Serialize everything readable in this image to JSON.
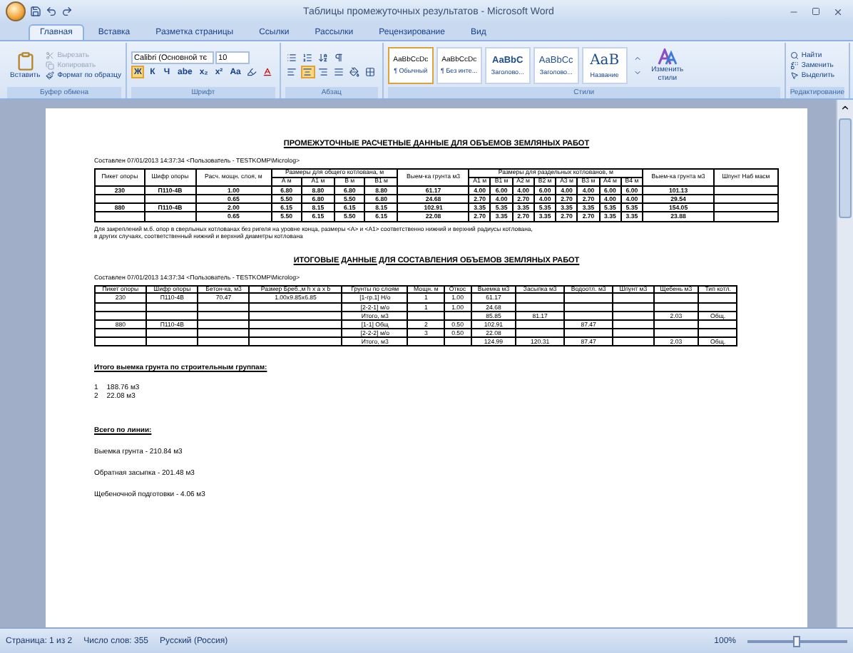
{
  "window": {
    "title": "Таблицы промежуточных результатов - Microsoft Word"
  },
  "tabs": [
    {
      "label": "Главная",
      "selected": true
    },
    {
      "label": "Вставка",
      "selected": false
    },
    {
      "label": "Разметка страницы",
      "selected": false
    },
    {
      "label": "Ссылки",
      "selected": false
    },
    {
      "label": "Рассылки",
      "selected": false
    },
    {
      "label": "Рецензирование",
      "selected": false
    },
    {
      "label": "Вид",
      "selected": false
    }
  ],
  "clipboard": {
    "group": "Буфер обмена",
    "paste": "Вставить",
    "items": [
      {
        "kind": "cut",
        "label": "Вырезать",
        "disabled": true
      },
      {
        "kind": "copy",
        "label": "Копировать",
        "disabled": true
      },
      {
        "kind": "format",
        "label": "Формат по образцу",
        "disabled": false
      }
    ]
  },
  "font": {
    "group": "Шрифт",
    "name": "Calibri (Основной тє",
    "size": "10",
    "buttons": [
      {
        "label": "Ж",
        "on": true
      },
      {
        "label": "К",
        "on": false
      },
      {
        "label": "Ч",
        "on": false
      },
      {
        "label": "abe",
        "on": false
      },
      {
        "label": "x₂",
        "on": false
      },
      {
        "label": "x²",
        "on": false
      },
      {
        "label": "Aa",
        "on": false
      }
    ]
  },
  "paragraph": {
    "group": "Абзац",
    "align": [
      {
        "kind": "left",
        "selected": false
      },
      {
        "kind": "center",
        "selected": true
      },
      {
        "kind": "right",
        "selected": false
      },
      {
        "kind": "justify",
        "selected": false
      }
    ]
  },
  "styles": {
    "group": "Стили",
    "items": [
      {
        "preview": "AaBbCcDc",
        "label": "¶ Обычный",
        "kind": "normal",
        "selected": true
      },
      {
        "preview": "AaBbCcDc",
        "label": "¶ Без инте...",
        "kind": "normal",
        "selected": false
      },
      {
        "preview": "AaBbC",
        "label": "Заголово...",
        "kind": "heading",
        "selected": false
      },
      {
        "preview": "AaBbCc",
        "label": "Заголово...",
        "kind": "heading2",
        "selected": false
      },
      {
        "preview": "AaB",
        "label": "Название",
        "kind": "title",
        "selected": false
      }
    ],
    "change": "Изменить стили"
  },
  "editing": {
    "group": "Редактирование",
    "items": [
      {
        "kind": "find",
        "label": "Найти"
      },
      {
        "kind": "replace",
        "label": "Заменить"
      },
      {
        "kind": "select",
        "label": "Выделить"
      }
    ]
  },
  "document": {
    "title1": "ПРОМЕЖУТОЧНЫЕ  РАСЧЕТНЫЕ ДАННЫЕ ДЛЯ ОБЪЕМОВ ЗЕМЛЯНЫХ РАБОТ",
    "author1": "Составлен 07/01/2013 14:37:34 <Пользователь - TESTKOMP\\Microlog>",
    "table1": {
      "columns": [
        {
          "label": "Пикет опоры"
        },
        {
          "label": "Шифр опоры"
        },
        {
          "label": "Расч. мощн. слоя, м"
        },
        {
          "label": "Размеры для общего котлована, м",
          "colspan": 4,
          "columns": [
            "А м",
            "А1 м",
            "В м",
            "В1 м"
          ]
        },
        {
          "label": "Выем-ка грунта м3"
        },
        {
          "label": "Размеры для раздельных котлованов, м",
          "colspan": 8,
          "columns": [
            "А1 м",
            "В1 м",
            "А2 м",
            "В2 м",
            "А3 м",
            "В3 м",
            "А4 м",
            "В4 м"
          ]
        },
        {
          "label": "Выем-ка грунта м3"
        },
        {
          "label": "Шпунт Наб масм"
        }
      ],
      "rows": [
        [
          "230",
          "П110-4В",
          "1.00",
          "6.80",
          "8.80",
          "6.80",
          "8.80",
          "61.17",
          "4.00",
          "6.00",
          "4.00",
          "6.00",
          "4.00",
          "4.00",
          "6.00",
          "6.00",
          "101.13",
          null
        ],
        [
          null,
          null,
          "0.65",
          "5.50",
          "6.80",
          "5.50",
          "6.80",
          "24.68",
          "2.70",
          "4.00",
          "2.70",
          "4.00",
          "2.70",
          "2.70",
          "4.00",
          "4.00",
          "29.54",
          null
        ],
        [
          "880",
          "П110-4В",
          "2.00",
          "6.15",
          "8.15",
          "6.15",
          "8.15",
          "102.91",
          "3.35",
          "5.35",
          "3.35",
          "5.35",
          "3.35",
          "3.35",
          "5.35",
          "5.35",
          "154.05",
          null
        ],
        [
          null,
          null,
          "0.65",
          "5.50",
          "6.15",
          "5.50",
          "6.15",
          "22.08",
          "2.70",
          "3.35",
          "2.70",
          "3.35",
          "2.70",
          "2.70",
          "3.35",
          "3.35",
          "23.88",
          null
        ]
      ]
    },
    "note": [
      "Для закреплений м.б. опор в сверлыных котлованах без ригеля на уровне конца, размеры <A> и <A1> соответственно нижний и верхний радиусы котлована,",
      "в других случаях, соответственный нижний и верхний диаметры котлована"
    ],
    "title2": "ИТОГОВЫЕ ДАННЫЕ ДЛЯ СОСТАВЛЕНИЯ ОБЪЕМОВ ЗЕМЛЯНЫХ РАБОТ",
    "author2": "Составлен 07/01/2013 14:37:34 <Пользователь - TESTKOMP\\Microlog>",
    "table2": {
      "columns": [
        {
          "label": "Пикет опоры"
        },
        {
          "label": "Шифр опоры"
        },
        {
          "label": "Бетон-ка, м3"
        },
        {
          "label": "Размер Бреб.,м h x a x b"
        },
        {
          "label": "Грунты по слоям"
        },
        {
          "label": "Мощн. м"
        },
        {
          "label": "Откос"
        },
        {
          "label": "Выемка м3"
        },
        {
          "label": "Засыпка м3"
        },
        {
          "label": "Водоотл. м3"
        },
        {
          "label": "Шпунт м3"
        },
        {
          "label": "Щебень м3"
        },
        {
          "label": "Тип котл."
        }
      ],
      "rows": [
        [
          "230",
          "П110-4В",
          "70.47",
          "1.00x9.85x6.85",
          "[1-гр.1] Н/о",
          "1",
          "1.00",
          "61.17",
          null,
          null,
          null,
          null,
          null
        ],
        [
          null,
          null,
          null,
          null,
          "[2-2-1] м/о",
          "1",
          "1.00",
          "24.68",
          null,
          null,
          null,
          null,
          null
        ],
        [
          null,
          null,
          null,
          null,
          "Итого, м3",
          null,
          null,
          "85.85",
          "81.17",
          null,
          null,
          "2.03",
          "Общ."
        ],
        [
          "880",
          "П110-4В",
          null,
          null,
          "[1-1] Общ",
          "2",
          "0.50",
          "102.91",
          null,
          "87.47",
          null,
          null,
          null
        ],
        [
          null,
          null,
          null,
          null,
          "[2-2-2] м/о",
          "3",
          "0.50",
          "22.08",
          null,
          null,
          null,
          null,
          null
        ],
        [
          null,
          null,
          null,
          null,
          "Итого, м3",
          null,
          null,
          "124.99",
          "120.31",
          "87.47",
          null,
          "2.03",
          "Общ."
        ]
      ]
    },
    "groups_title": "Итого выемка  грунта по строительным  группам:",
    "groups": [
      {
        "number": "1",
        "value": "188.76 м3"
      },
      {
        "number": "2",
        "value": "22.08 м3"
      }
    ],
    "total_title": "Всего по линии:",
    "totals": [
      "Выемка грунта  - 210.84 м3",
      "Обратная засыпка - 201.48 м3",
      "Щебеночной подготовки - 4.06 м3"
    ]
  },
  "status_bar": {
    "page": "Страница: 1 из 2",
    "words": "Число слов: 355",
    "language": "Русский (Россия)",
    "zoom": "100%",
    "zoom_slider": {
      "level": 0.5
    }
  }
}
